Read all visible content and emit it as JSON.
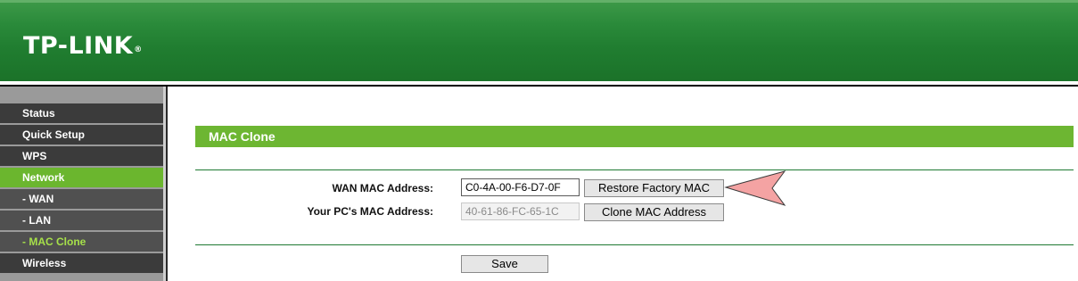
{
  "brand": {
    "logo_text": "TP-LINK",
    "trademark": "®"
  },
  "sidebar": {
    "items": [
      {
        "label": "Status"
      },
      {
        "label": "Quick Setup"
      },
      {
        "label": "WPS"
      },
      {
        "label": "Network",
        "state": "active"
      },
      {
        "label": "- WAN"
      },
      {
        "label": "- LAN"
      },
      {
        "label": "- MAC Clone",
        "state": "current"
      },
      {
        "label": "Wireless"
      }
    ]
  },
  "main": {
    "section_title": "MAC Clone",
    "wan_mac_label": "WAN MAC Address:",
    "wan_mac_value": "C0-4A-00-F6-D7-0F",
    "pc_mac_label": "Your PC's MAC Address:",
    "pc_mac_value": "40-61-86-FC-65-1C",
    "restore_button": "Restore Factory MAC",
    "clone_button": "Clone MAC Address",
    "save_button": "Save"
  },
  "colors": {
    "header_green": "#207d30",
    "section_green": "#6db632",
    "active_menu": "#6bb62e",
    "current_submenu_text": "#a6e04a",
    "arrow_fill": "#f4a3a3"
  },
  "annotation": {
    "icon": "pointer-arrow-icon"
  }
}
